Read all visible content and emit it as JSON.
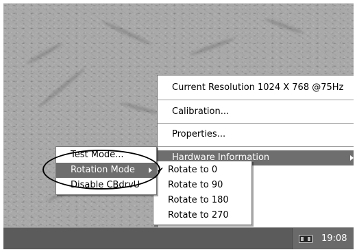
{
  "context_menu": {
    "current_resolution": "Current Resolution  1024 X 768 @75Hz",
    "calibration": "Calibration...",
    "properties": "Properties...",
    "hardware_information": "Hardware Information"
  },
  "tool_menu": {
    "test_mode": "Test Mode...",
    "rotation_mode": "Rotation Mode",
    "disable": "Disable CBdrvU"
  },
  "rotation_menu": {
    "items": [
      "Rotate to 0",
      "Rotate to 90",
      "Rotate to 180",
      "Rotate to 270"
    ],
    "checked_index": 0
  },
  "taskbar": {
    "clock": "19:08",
    "tray_icon": "display-icon"
  },
  "colors": {
    "highlight": "#6e6e6e",
    "taskbar": "#5b5b5b"
  }
}
